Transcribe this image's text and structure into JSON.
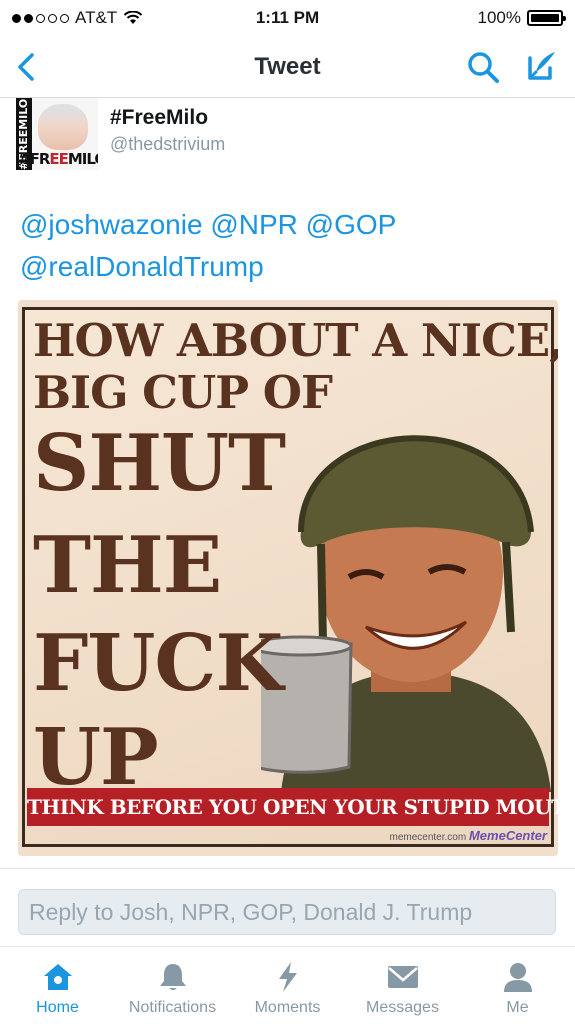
{
  "status_bar": {
    "carrier": "AT&T",
    "time": "1:11 PM",
    "battery": "100%",
    "battery_level": 1.0
  },
  "nav": {
    "title": "Tweet",
    "back_icon": "chevron-left-icon",
    "search_icon": "search-icon",
    "compose_icon": "compose-icon"
  },
  "tweet": {
    "display_name": "#FreeMilo",
    "handle": "@thedstrivium",
    "avatar_text_side": "#FREEMILO",
    "avatar_text_bottom_1": "#FR",
    "avatar_text_bottom_2": "EE",
    "avatar_text_bottom_3": "MILO",
    "mentions": [
      "@joshwazonie",
      "@NPR",
      "@GOP",
      "@realDonaldTrump"
    ],
    "image": {
      "line1": "HOW ABOUT A NICE,",
      "line2": "BIG CUP OF",
      "line3": "SHUT",
      "line4": "THE",
      "line5": "FUCK",
      "line6": "UP",
      "banner": "THINK BEFORE YOU OPEN YOUR STUPID MOUTH!",
      "credit_site": "memecenter.com",
      "credit_logo": "MemeCenter"
    }
  },
  "reply": {
    "placeholder": "Reply to Josh, NPR, GOP, Donald J. Trump"
  },
  "tabs": [
    {
      "label": "Home",
      "icon": "home-icon",
      "active": true
    },
    {
      "label": "Notifications",
      "icon": "bell-icon",
      "active": false
    },
    {
      "label": "Moments",
      "icon": "lightning-icon",
      "active": false
    },
    {
      "label": "Messages",
      "icon": "envelope-icon",
      "active": false
    },
    {
      "label": "Me",
      "icon": "person-icon",
      "active": false
    }
  ],
  "colors": {
    "accent": "#1b95e0",
    "inactive": "#8899a6",
    "banner_red": "#b42025"
  }
}
